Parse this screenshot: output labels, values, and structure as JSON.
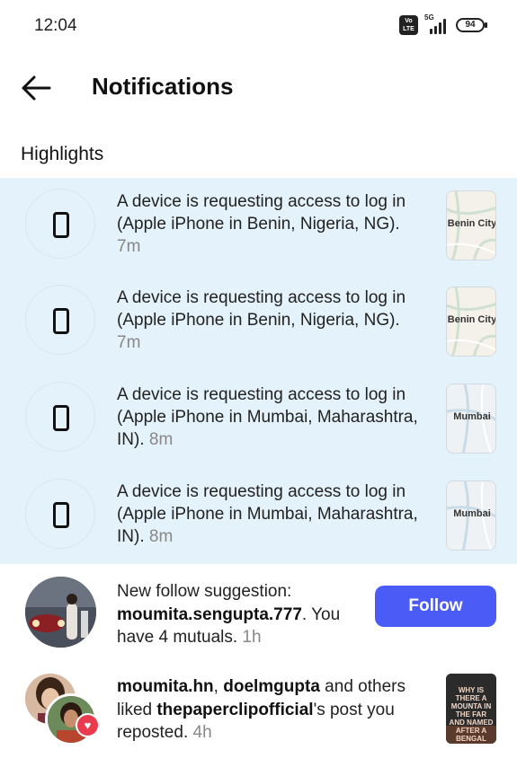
{
  "status_bar": {
    "time": "12:04",
    "volte_top": "Vo",
    "volte_bottom": "LTE",
    "network": "5G",
    "battery": "94"
  },
  "header": {
    "title": "Notifications",
    "back_icon": "arrow-left-icon"
  },
  "section_title": "Highlights",
  "highlights": [
    {
      "message": "A device is requesting access to log in (Apple iPhone in Benin, Nigeria, NG).",
      "time": "7m",
      "map_label": "Benin City"
    },
    {
      "message": "A device is requesting access to log in (Apple iPhone in Benin, Nigeria, NG).",
      "time": "7m",
      "map_label": "Benin City"
    },
    {
      "message": "A device is requesting access to log in (Apple iPhone in Mumbai, Maharashtra, IN).",
      "time": "8m",
      "map_label": "Mumbai"
    },
    {
      "message": "A device is requesting access to log in (Apple iPhone in Mumbai, Maharashtra, IN).",
      "time": "8m",
      "map_label": "Mumbai"
    }
  ],
  "suggestion": {
    "prefix": "New follow suggestion:",
    "username": "moumita.sengupta.777",
    "suffix": ". You have 4 mutuals.",
    "time": "1h",
    "follow_label": "Follow"
  },
  "like_notification": {
    "user1": "moumita.hn",
    "sep": ", ",
    "user2": "doelmgupta",
    "middle": " and others liked ",
    "account": "thepaperclipofficial",
    "suffix": "'s post you reposted.",
    "time": "4h",
    "thumb_text": "WHY IS THERE A MOUNTA IN THE FAR AND NAMED AFTER A BENGAL MAJO"
  },
  "colors": {
    "highlight_bg": "#e4f2fb",
    "follow_button": "#4a5cf5",
    "heart_badge": "#ea3a4d"
  }
}
